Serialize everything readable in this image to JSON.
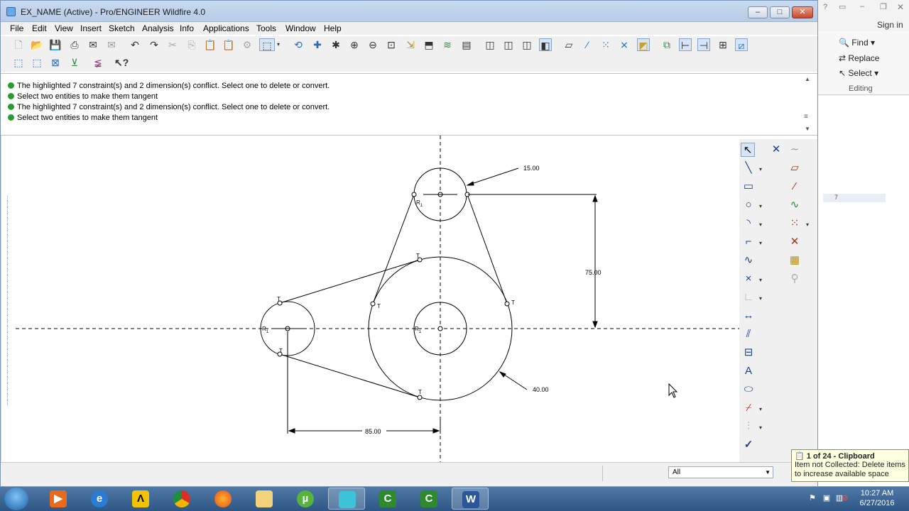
{
  "window": {
    "title": "EX_NAME (Active) - Pro/ENGINEER Wildfire 4.0",
    "minimize": "–",
    "maximize": "□",
    "close": "✕"
  },
  "menu": [
    "File",
    "Edit",
    "View",
    "Insert",
    "Sketch",
    "Analysis",
    "Info",
    "Applications",
    "Tools",
    "Window",
    "Help"
  ],
  "messages": [
    "The highlighted 7 constraint(s) and 2 dimension(s) conflict. Select one to delete or convert.",
    "Select two entities to make them tangent",
    "The highlighted 7 constraint(s) and 2 dimension(s) conflict. Select one to delete or convert.",
    "Select two entities to make them tangent"
  ],
  "sketch": {
    "dim_top_radius": "15.00",
    "dim_vertical": "75.00",
    "dim_big_radius": "40.00",
    "dim_horizontal": "85.00",
    "tangent_marker": "T",
    "radius_marker": "R",
    "radius_sub": "1"
  },
  "status": {
    "filter_value": "All"
  },
  "clipboard": {
    "title": "1 of 24 - Clipboard",
    "body_line1": "Item not Collected: Delete items",
    "body_line2": "to increase available space"
  },
  "word": {
    "sign_in": "Sign in",
    "find": "Find",
    "replace": "Replace",
    "select": "Select",
    "group": "Editing",
    "ruler": "7"
  },
  "taskbar": {
    "time": "10:27 AM",
    "date": "6/27/2016"
  }
}
